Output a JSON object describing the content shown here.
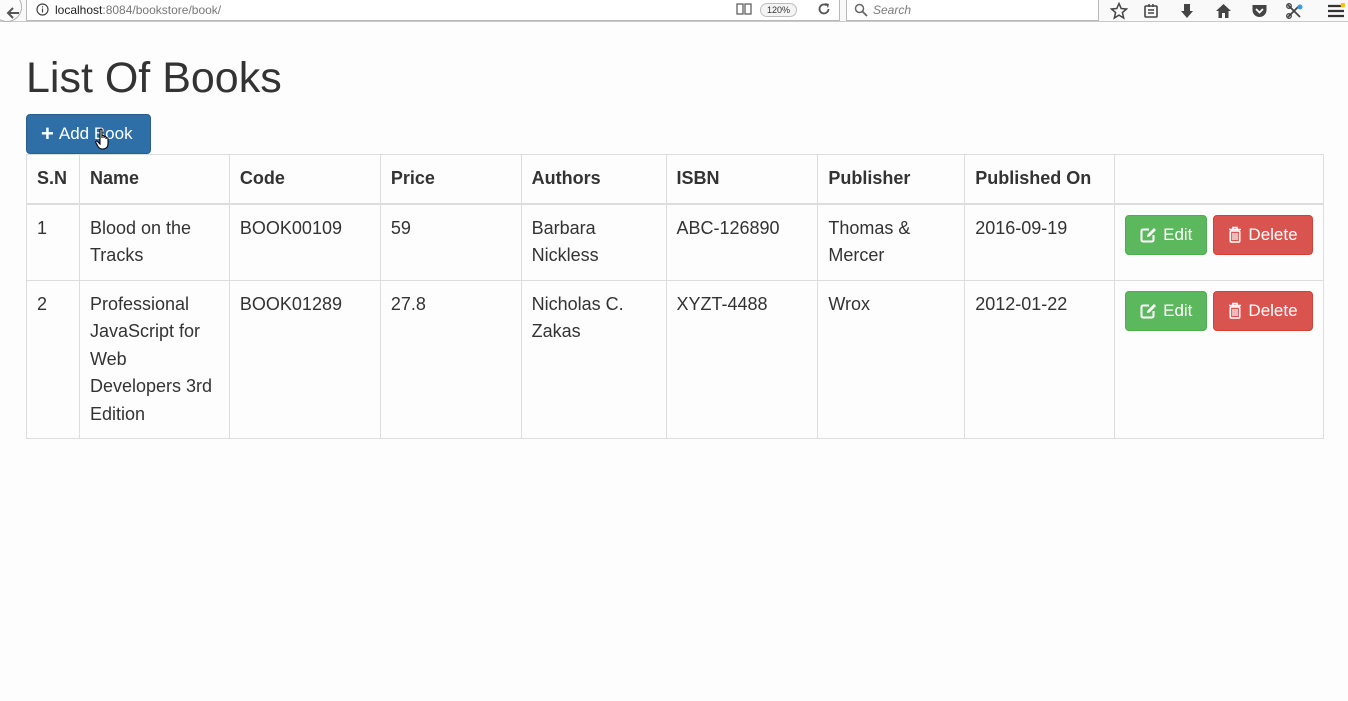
{
  "browser": {
    "url_host": "localhost",
    "url_rest": ":8084/bookstore/book/",
    "zoom": "120%",
    "search_placeholder": "Search"
  },
  "page": {
    "title": "List Of Books",
    "add_label": "Add Book"
  },
  "table": {
    "headers": [
      "S.N",
      "Name",
      "Code",
      "Price",
      "Authors",
      "ISBN",
      "Publisher",
      "Published On",
      ""
    ],
    "rows": [
      {
        "sn": "1",
        "name": "Blood on the Tracks",
        "code": "BOOK00109",
        "price": "59",
        "authors": "Barbara Nickless",
        "isbn": "ABC-126890",
        "publisher": "Thomas & Mercer",
        "published_on": "2016-09-19",
        "edit_label": "Edit",
        "delete_label": "Delete"
      },
      {
        "sn": "2",
        "name": "Professional JavaScript for Web Developers 3rd Edition",
        "code": "BOOK01289",
        "price": "27.8",
        "authors": "Nicholas C. Zakas",
        "isbn": "XYZT-4488",
        "publisher": "Wrox",
        "published_on": "2012-01-22",
        "edit_label": "Edit",
        "delete_label": "Delete"
      }
    ]
  },
  "colors": {
    "primary": "#2f6fa8",
    "success": "#5cb85c",
    "danger": "#d9534f"
  },
  "icons": [
    "back-arrow-icon",
    "info-icon",
    "reader-icon",
    "reload-icon",
    "search-icon",
    "bookmark-star-icon",
    "bookmarks-list-icon",
    "download-icon",
    "home-icon",
    "pocket-icon",
    "extension-icon",
    "menu-icon",
    "plus-icon",
    "edit-icon",
    "trash-icon",
    "hand-cursor-icon"
  ]
}
